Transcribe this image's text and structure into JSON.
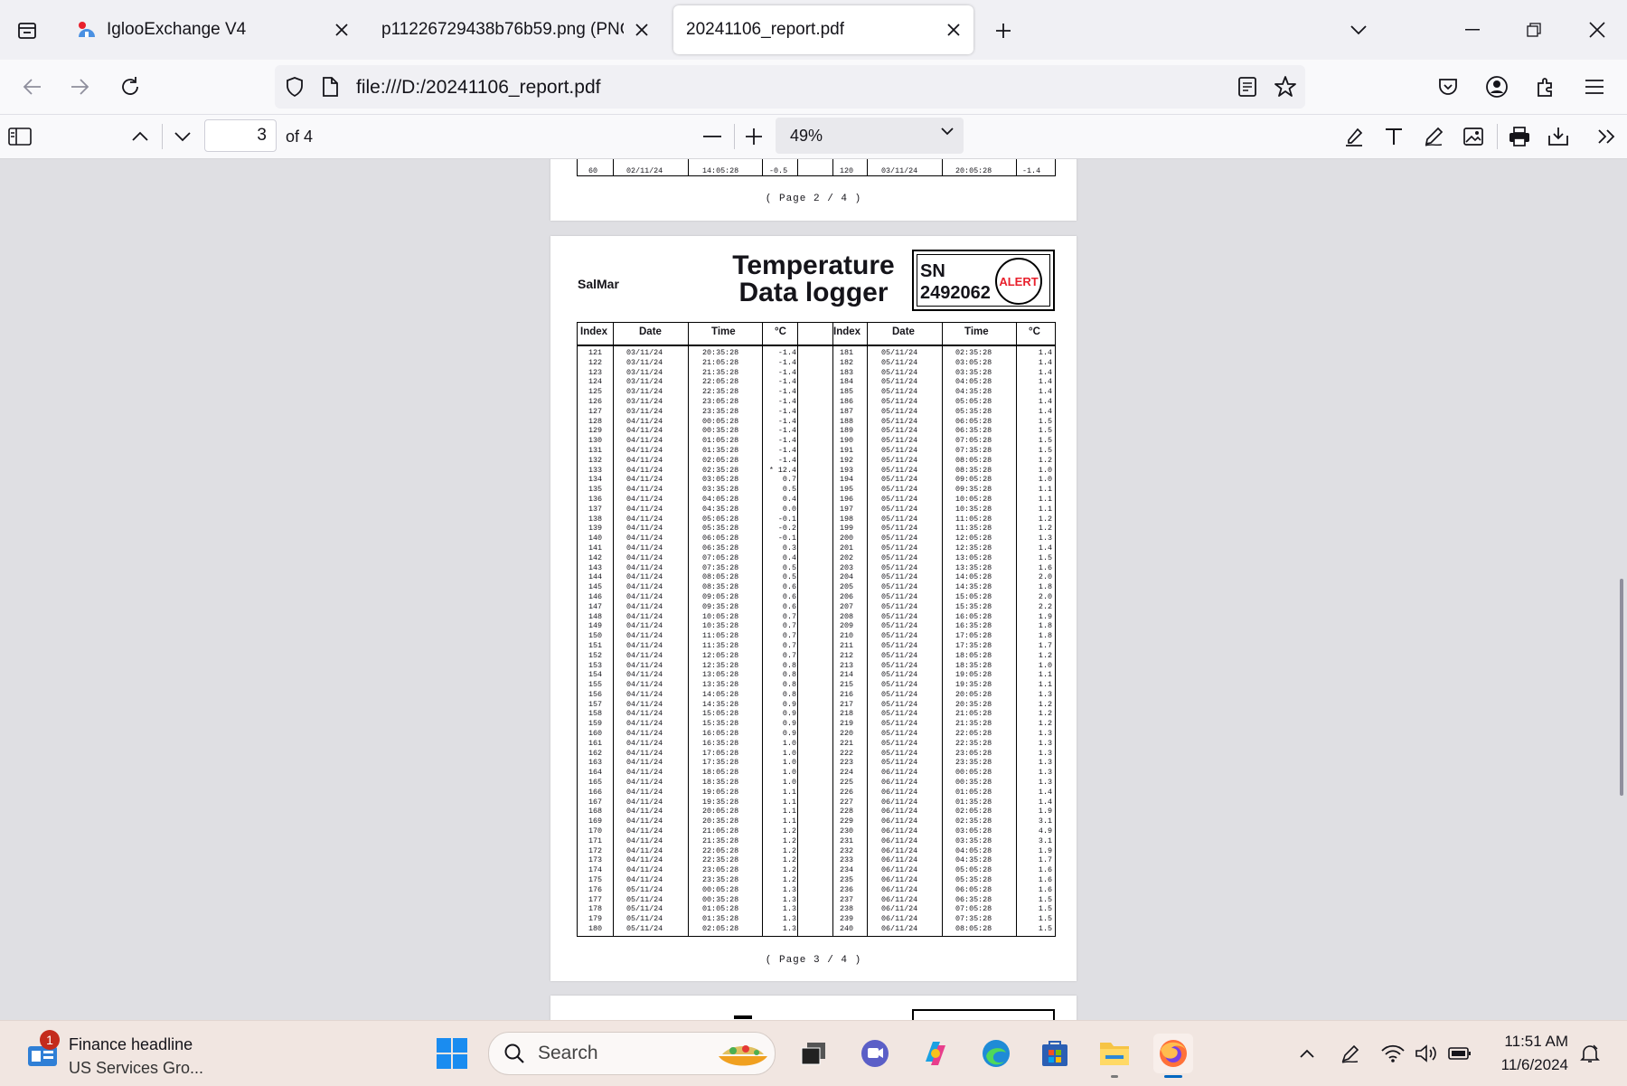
{
  "tabs": [
    {
      "title": "IglooExchange V4",
      "active": false
    },
    {
      "title": "p11226729438b76b59.png (PNG Im",
      "active": false
    },
    {
      "title": "20241106_report.pdf",
      "active": true
    }
  ],
  "navbar": {
    "url": "file:///D:/20241106_report.pdf"
  },
  "pdf_toolbar": {
    "page_number": "3",
    "page_count_label": "of 4",
    "zoom": "49%"
  },
  "page2_fragment": {
    "left_row": {
      "index": "60",
      "date": "02/11/24",
      "time": "14:05:28",
      "temp": "-0.5"
    },
    "right_row": {
      "index": "120",
      "date": "03/11/24",
      "time": "20:05:28",
      "temp": "-1.4"
    },
    "footer": "( Page   2 / 4 )"
  },
  "report_page": {
    "company": "SalMar",
    "title_line1": "Temperature",
    "title_line2": "Data logger",
    "sn_label": "SN",
    "serial_number": "2492062",
    "alert_label": "ALERT",
    "headers": {
      "index": "Index",
      "date": "Date",
      "time": "Time",
      "temp": "°C"
    },
    "left_block": {
      "index": "121\n122\n123\n124\n125\n126\n127\n128\n129\n130\n131\n132\n133\n134\n135\n136\n137\n138\n139\n140\n141\n142\n143\n144\n145\n146\n147\n148\n149\n150\n151\n152\n153\n154\n155\n156\n157\n158\n159\n160\n161\n162\n163\n164\n165\n166\n167\n168\n169\n170\n171\n172\n173\n174\n175\n176\n177\n178\n179\n180",
      "date": "03/11/24\n03/11/24\n03/11/24\n03/11/24\n03/11/24\n03/11/24\n03/11/24\n04/11/24\n04/11/24\n04/11/24\n04/11/24\n04/11/24\n04/11/24\n04/11/24\n04/11/24\n04/11/24\n04/11/24\n04/11/24\n04/11/24\n04/11/24\n04/11/24\n04/11/24\n04/11/24\n04/11/24\n04/11/24\n04/11/24\n04/11/24\n04/11/24\n04/11/24\n04/11/24\n04/11/24\n04/11/24\n04/11/24\n04/11/24\n04/11/24\n04/11/24\n04/11/24\n04/11/24\n04/11/24\n04/11/24\n04/11/24\n04/11/24\n04/11/24\n04/11/24\n04/11/24\n04/11/24\n04/11/24\n04/11/24\n04/11/24\n04/11/24\n04/11/24\n04/11/24\n04/11/24\n04/11/24\n04/11/24\n05/11/24\n05/11/24\n05/11/24\n05/11/24\n05/11/24",
      "time": "20:35:28\n21:05:28\n21:35:28\n22:05:28\n22:35:28\n23:05:28\n23:35:28\n00:05:28\n00:35:28\n01:05:28\n01:35:28\n02:05:28\n02:35:28\n03:05:28\n03:35:28\n04:05:28\n04:35:28\n05:05:28\n05:35:28\n06:05:28\n06:35:28\n07:05:28\n07:35:28\n08:05:28\n08:35:28\n09:05:28\n09:35:28\n10:05:28\n10:35:28\n11:05:28\n11:35:28\n12:05:28\n12:35:28\n13:05:28\n13:35:28\n14:05:28\n14:35:28\n15:05:28\n15:35:28\n16:05:28\n16:35:28\n17:05:28\n17:35:28\n18:05:28\n18:35:28\n19:05:28\n19:35:28\n20:05:28\n20:35:28\n21:05:28\n21:35:28\n22:05:28\n22:35:28\n23:05:28\n23:35:28\n00:05:28\n00:35:28\n01:05:28\n01:35:28\n02:05:28",
      "temp": "-1.4\n-1.4\n-1.4\n-1.4\n-1.4\n-1.4\n-1.4\n-1.4\n-1.4\n-1.4\n-1.4\n-1.4\n* 12.4\n0.7\n0.5\n0.4\n0.0\n-0.1\n-0.2\n-0.1\n0.3\n0.4\n0.5\n0.5\n0.6\n0.6\n0.6\n0.7\n0.7\n0.7\n0.7\n0.7\n0.8\n0.8\n0.8\n0.8\n0.9\n0.9\n0.9\n0.9\n1.0\n1.0\n1.0\n1.0\n1.0\n1.1\n1.1\n1.1\n1.1\n1.2\n1.2\n1.2\n1.2\n1.2\n1.2\n1.3\n1.3\n1.3\n1.3\n1.3"
    },
    "right_block": {
      "index": "181\n182\n183\n184\n185\n186\n187\n188\n189\n190\n191\n192\n193\n194\n195\n196\n197\n198\n199\n200\n201\n202\n203\n204\n205\n206\n207\n208\n209\n210\n211\n212\n213\n214\n215\n216\n217\n218\n219\n220\n221\n222\n223\n224\n225\n226\n227\n228\n229\n230\n231\n232\n233\n234\n235\n236\n237\n238\n239\n240",
      "date": "05/11/24\n05/11/24\n05/11/24\n05/11/24\n05/11/24\n05/11/24\n05/11/24\n05/11/24\n05/11/24\n05/11/24\n05/11/24\n05/11/24\n05/11/24\n05/11/24\n05/11/24\n05/11/24\n05/11/24\n05/11/24\n05/11/24\n05/11/24\n05/11/24\n05/11/24\n05/11/24\n05/11/24\n05/11/24\n05/11/24\n05/11/24\n05/11/24\n05/11/24\n05/11/24\n05/11/24\n05/11/24\n05/11/24\n05/11/24\n05/11/24\n05/11/24\n05/11/24\n05/11/24\n05/11/24\n05/11/24\n05/11/24\n05/11/24\n05/11/24\n06/11/24\n06/11/24\n06/11/24\n06/11/24\n06/11/24\n06/11/24\n06/11/24\n06/11/24\n06/11/24\n06/11/24\n06/11/24\n06/11/24\n06/11/24\n06/11/24\n06/11/24\n06/11/24\n06/11/24",
      "time": "02:35:28\n03:05:28\n03:35:28\n04:05:28\n04:35:28\n05:05:28\n05:35:28\n06:05:28\n06:35:28\n07:05:28\n07:35:28\n08:05:28\n08:35:28\n09:05:28\n09:35:28\n10:05:28\n10:35:28\n11:05:28\n11:35:28\n12:05:28\n12:35:28\n13:05:28\n13:35:28\n14:05:28\n14:35:28\n15:05:28\n15:35:28\n16:05:28\n16:35:28\n17:05:28\n17:35:28\n18:05:28\n18:35:28\n19:05:28\n19:35:28\n20:05:28\n20:35:28\n21:05:28\n21:35:28\n22:05:28\n22:35:28\n23:05:28\n23:35:28\n00:05:28\n00:35:28\n01:05:28\n01:35:28\n02:05:28\n02:35:28\n03:05:28\n03:35:28\n04:05:28\n04:35:28\n05:05:28\n05:35:28\n06:05:28\n06:35:28\n07:05:28\n07:35:28\n08:05:28",
      "temp": "1.4\n1.4\n1.4\n1.4\n1.4\n1.4\n1.4\n1.5\n1.5\n1.5\n1.5\n1.2\n1.0\n1.0\n1.1\n1.1\n1.1\n1.2\n1.2\n1.3\n1.4\n1.5\n1.6\n2.0\n1.8\n2.0\n2.2\n1.9\n1.8\n1.8\n1.7\n1.2\n1.0\n1.1\n1.1\n1.3\n1.2\n1.2\n1.2\n1.3\n1.3\n1.3\n1.3\n1.3\n1.3\n1.4\n1.4\n1.9\n3.1\n4.9\n3.1\n1.9\n1.7\n1.6\n1.6\n1.6\n1.5\n1.5\n1.5\n1.5"
    },
    "footer": "( Page   3 / 4 )"
  },
  "taskbar": {
    "news_badge": "1",
    "news_title": "Finance headline",
    "news_subtitle": "US Services Gro...",
    "search_placeholder": "Search",
    "time": "11:51 AM",
    "date": "11/6/2024"
  },
  "colors": {
    "alert": "#e8202c",
    "accent": "#0060df",
    "taskbar": "#f1e6e1"
  }
}
